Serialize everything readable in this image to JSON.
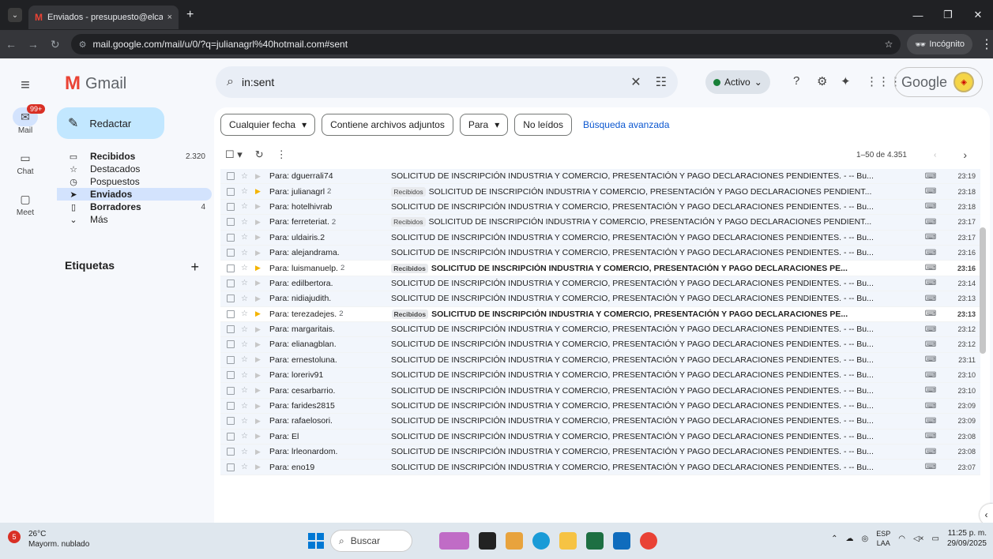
{
  "browser": {
    "tab_title": "Enviados - presupuesto@elcam",
    "tab_close": "×",
    "new_tab": "+",
    "url": "mail.google.com/mail/u/0/?q=julianagrl%40hotmail.com#sent",
    "incognito_label": "Incógnito"
  },
  "gmail": {
    "app_name": "Gmail",
    "search_query": "in:sent",
    "status_label": "Activo",
    "google_wordmark": "Google"
  },
  "rail": {
    "mail_label": "Mail",
    "mail_badge": "99+",
    "chat_label": "Chat",
    "meet_label": "Meet"
  },
  "sidebar": {
    "compose_label": "Redactar",
    "folders": [
      {
        "label": "Recibidos",
        "count": "2.320",
        "icon": "inbox-icon"
      },
      {
        "label": "Destacados",
        "count": "",
        "icon": "star-icon"
      },
      {
        "label": "Pospuestos",
        "count": "",
        "icon": "clock-icon"
      },
      {
        "label": "Enviados",
        "count": "",
        "icon": "send-icon"
      },
      {
        "label": "Borradores",
        "count": "4",
        "icon": "draft-icon"
      },
      {
        "label": "Más",
        "count": "",
        "icon": "chevron-down-icon"
      }
    ],
    "labels_header": "Etiquetas"
  },
  "filters": {
    "date_chip": "Cualquier fecha",
    "attachments_chip": "Contiene archivos adjuntos",
    "to_chip": "Para",
    "unread_chip": "No leídos",
    "advanced_search": "Búsqueda avanzada"
  },
  "toolbar": {
    "pagination": "1–50 de 4.351"
  },
  "emails": [
    {
      "to": "Para: dguerrali74",
      "count": "",
      "label": "",
      "subject": "SOLICITUD DE INSCRIPCIÓN INDUSTRIA Y COMERCIO, PRESENTACIÓN Y PAGO DECLARACIONES PENDIENTES. - -- Bu...",
      "time": "23:19",
      "unread": false,
      "important": false
    },
    {
      "to": "Para: julianagrl",
      "count": "2",
      "label": "Recibidos",
      "subject": "SOLICITUD DE INSCRIPCIÓN INDUSTRIA Y COMERCIO, PRESENTACIÓN Y PAGO DECLARACIONES PENDIENT...",
      "time": "23:18",
      "unread": false,
      "important": true
    },
    {
      "to": "Para: hotelhivrab",
      "count": "",
      "label": "",
      "subject": "SOLICITUD DE INSCRIPCIÓN INDUSTRIA Y COMERCIO, PRESENTACIÓN Y PAGO DECLARACIONES PENDIENTES. - -- Bu...",
      "time": "23:18",
      "unread": false,
      "important": false
    },
    {
      "to": "Para: ferreteriat.",
      "count": "2",
      "label": "Recibidos",
      "subject": "SOLICITUD DE INSCRIPCIÓN INDUSTRIA Y COMERCIO, PRESENTACIÓN Y PAGO DECLARACIONES PENDIENT...",
      "time": "23:17",
      "unread": false,
      "important": false
    },
    {
      "to": "Para: uldairis.2",
      "count": "",
      "label": "",
      "subject": "SOLICITUD DE INSCRIPCIÓN INDUSTRIA Y COMERCIO, PRESENTACIÓN Y PAGO DECLARACIONES PENDIENTES. - -- Bu...",
      "time": "23:17",
      "unread": false,
      "important": false
    },
    {
      "to": "Para: alejandrama.",
      "count": "",
      "label": "",
      "subject": "SOLICITUD DE INSCRIPCIÓN INDUSTRIA Y COMERCIO, PRESENTACIÓN Y PAGO DECLARACIONES PENDIENTES. - -- Bu...",
      "time": "23:16",
      "unread": false,
      "important": false
    },
    {
      "to": "Para: luismanuelp.",
      "count": "2",
      "label": "Recibidos",
      "subject": "SOLICITUD DE INSCRIPCIÓN INDUSTRIA Y COMERCIO, PRESENTACIÓN Y PAGO DECLARACIONES PE...",
      "time": "23:16",
      "unread": true,
      "important": true
    },
    {
      "to": "Para: edilbertora.",
      "count": "",
      "label": "",
      "subject": "SOLICITUD DE INSCRIPCIÓN INDUSTRIA Y COMERCIO, PRESENTACIÓN Y PAGO DECLARACIONES PENDIENTES. - -- Bu...",
      "time": "23:14",
      "unread": false,
      "important": false
    },
    {
      "to": "Para: nidiajudith.",
      "count": "",
      "label": "",
      "subject": "SOLICITUD DE INSCRIPCIÓN INDUSTRIA Y COMERCIO, PRESENTACIÓN Y PAGO DECLARACIONES PENDIENTES. - -- Bu...",
      "time": "23:13",
      "unread": false,
      "important": false
    },
    {
      "to": "Para: terezadejes.",
      "count": "2",
      "label": "Recibidos",
      "subject": "SOLICITUD DE INSCRIPCIÓN INDUSTRIA Y COMERCIO, PRESENTACIÓN Y PAGO DECLARACIONES PE...",
      "time": "23:13",
      "unread": true,
      "important": true
    },
    {
      "to": "Para: margaritais.",
      "count": "",
      "label": "",
      "subject": "SOLICITUD DE INSCRIPCIÓN INDUSTRIA Y COMERCIO, PRESENTACIÓN Y PAGO DECLARACIONES PENDIENTES. - -- Bu...",
      "time": "23:12",
      "unread": false,
      "important": false
    },
    {
      "to": "Para: elianagblan.",
      "count": "",
      "label": "",
      "subject": "SOLICITUD DE INSCRIPCIÓN INDUSTRIA Y COMERCIO, PRESENTACIÓN Y PAGO DECLARACIONES PENDIENTES. - -- Bu...",
      "time": "23:12",
      "unread": false,
      "important": false
    },
    {
      "to": "Para: ernestoluna.",
      "count": "",
      "label": "",
      "subject": "SOLICITUD DE INSCRIPCIÓN INDUSTRIA Y COMERCIO, PRESENTACIÓN Y PAGO DECLARACIONES PENDIENTES. - -- Bu...",
      "time": "23:11",
      "unread": false,
      "important": false
    },
    {
      "to": "Para: loreriv91",
      "count": "",
      "label": "",
      "subject": "SOLICITUD DE INSCRIPCIÓN INDUSTRIA Y COMERCIO, PRESENTACIÓN Y PAGO DECLARACIONES PENDIENTES. - -- Bu...",
      "time": "23:10",
      "unread": false,
      "important": false
    },
    {
      "to": "Para: cesarbarrio.",
      "count": "",
      "label": "",
      "subject": "SOLICITUD DE INSCRIPCIÓN INDUSTRIA Y COMERCIO, PRESENTACIÓN Y PAGO DECLARACIONES PENDIENTES. - -- Bu...",
      "time": "23:10",
      "unread": false,
      "important": false
    },
    {
      "to": "Para: farides2815",
      "count": "",
      "label": "",
      "subject": "SOLICITUD DE INSCRIPCIÓN INDUSTRIA Y COMERCIO, PRESENTACIÓN Y PAGO DECLARACIONES PENDIENTES. - -- Bu...",
      "time": "23:09",
      "unread": false,
      "important": false
    },
    {
      "to": "Para: rafaelosori.",
      "count": "",
      "label": "",
      "subject": "SOLICITUD DE INSCRIPCIÓN INDUSTRIA Y COMERCIO, PRESENTACIÓN Y PAGO DECLARACIONES PENDIENTES. - -- Bu...",
      "time": "23:09",
      "unread": false,
      "important": false
    },
    {
      "to": "Para: El",
      "count": "",
      "label": "",
      "subject": "SOLICITUD DE INSCRIPCIÓN INDUSTRIA Y COMERCIO, PRESENTACIÓN Y PAGO DECLARACIONES PENDIENTES. - -- Bu...",
      "time": "23:08",
      "unread": false,
      "important": false
    },
    {
      "to": "Para: lrleonardom.",
      "count": "",
      "label": "",
      "subject": "SOLICITUD DE INSCRIPCIÓN INDUSTRIA Y COMERCIO, PRESENTACIÓN Y PAGO DECLARACIONES PENDIENTES. - -- Bu...",
      "time": "23:08",
      "unread": false,
      "important": false
    },
    {
      "to": "Para: eno19",
      "count": "",
      "label": "",
      "subject": "SOLICITUD DE INSCRIPCIÓN INDUSTRIA Y COMERCIO, PRESENTACIÓN Y PAGO DECLARACIONES PENDIENTES. - -- Bu...",
      "time": "23:07",
      "unread": false,
      "important": false
    }
  ],
  "taskbar": {
    "weather_badge": "5",
    "temperature": "26°C",
    "weather_desc": "Mayorm. nublado",
    "search_placeholder": "Buscar",
    "lang_top": "ESP",
    "lang_bottom": "LAA",
    "time": "11:25 p. m.",
    "date": "29/09/2025"
  }
}
